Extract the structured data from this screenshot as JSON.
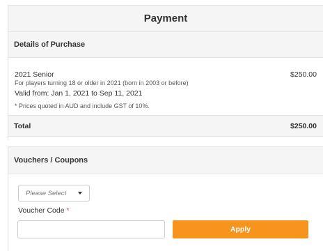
{
  "page": {
    "title": "Payment"
  },
  "details": {
    "header": "Details of Purchase",
    "item": {
      "name": "2021 Senior",
      "price": "$250.00",
      "description": "For players turning 18 or older in 2021 (born in 2003 or before)",
      "valid": "Valid from: Jan 1, 2021 to Sep 11, 2021"
    },
    "note": "* Prices quoted in AUD and include GST of 10%.",
    "total_label": "Total",
    "total_value": "$250.00"
  },
  "vouchers": {
    "header": "Vouchers / Coupons",
    "select": {
      "selected": "Please Select"
    },
    "code_label": "Voucher Code",
    "required_mark": "*",
    "code_value": "",
    "apply_label": "Apply"
  },
  "colors": {
    "accent": "#f7941d",
    "panel_bg": "#f5f5f5",
    "border": "#e2e2e2"
  }
}
